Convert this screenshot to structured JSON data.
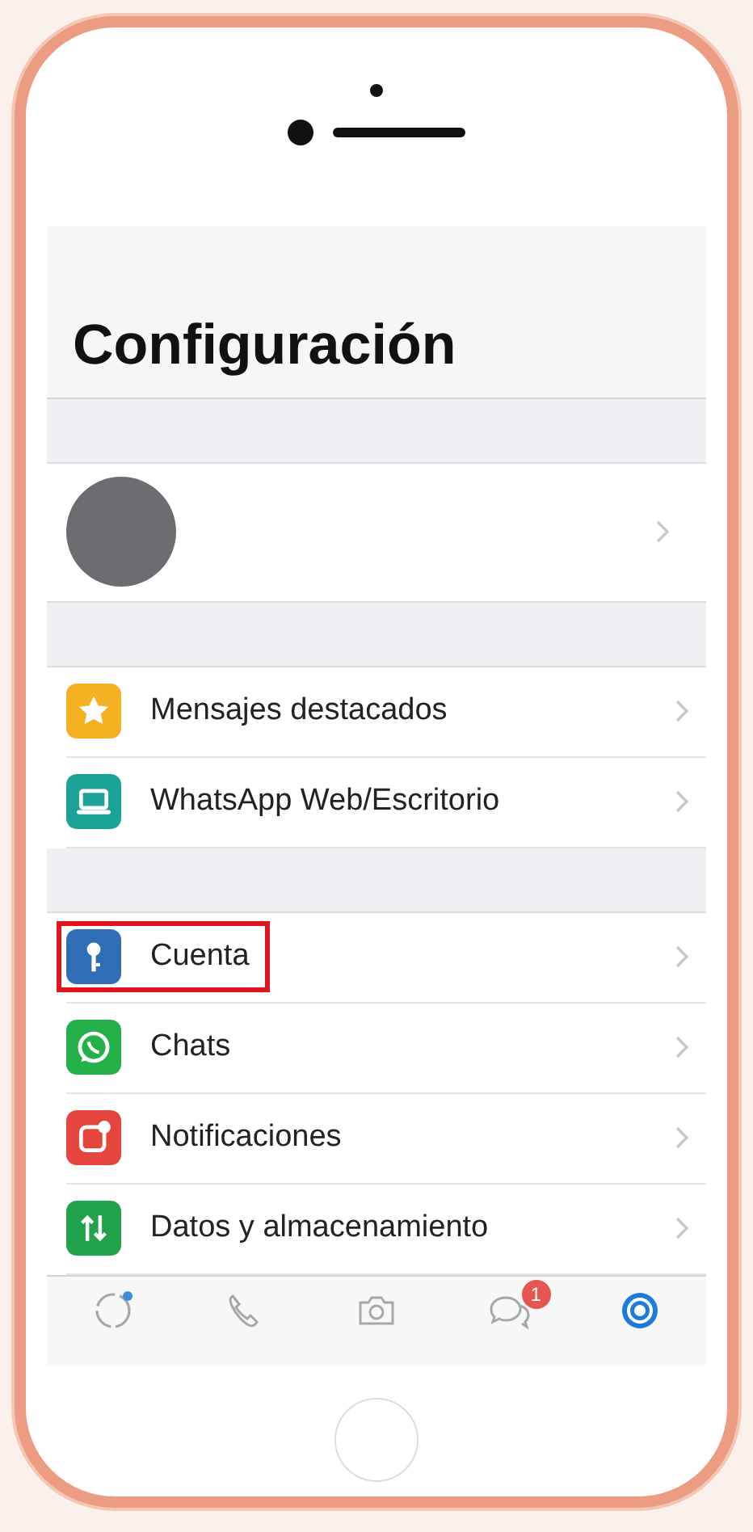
{
  "screen": {
    "title": "Configuración",
    "sections": [
      {
        "rows": [
          {
            "label": "Mensajes destacados",
            "kind": "star",
            "color": "#f4b223",
            "highlighted": false
          },
          {
            "label": "WhatsApp Web/Escritorio",
            "kind": "laptop",
            "color": "#1ba398",
            "highlighted": false
          }
        ]
      },
      {
        "rows": [
          {
            "label": "Cuenta",
            "kind": "key",
            "color": "#2f6db5",
            "highlighted": true
          },
          {
            "label": "Chats",
            "kind": "whatsapp",
            "color": "#25b04a",
            "highlighted": false
          },
          {
            "label": "Notificaciones",
            "kind": "notification",
            "color": "#e5453d",
            "highlighted": false
          },
          {
            "label": "Datos y almacenamiento",
            "kind": "arrows",
            "color": "#22a24a",
            "highlighted": false
          }
        ]
      }
    ],
    "tabs": [
      {
        "kind": "status",
        "selected": false
      },
      {
        "kind": "calls",
        "selected": false
      },
      {
        "kind": "camera",
        "selected": false
      },
      {
        "kind": "chats",
        "selected": false,
        "badge": "1"
      },
      {
        "kind": "settings",
        "selected": true
      }
    ]
  }
}
